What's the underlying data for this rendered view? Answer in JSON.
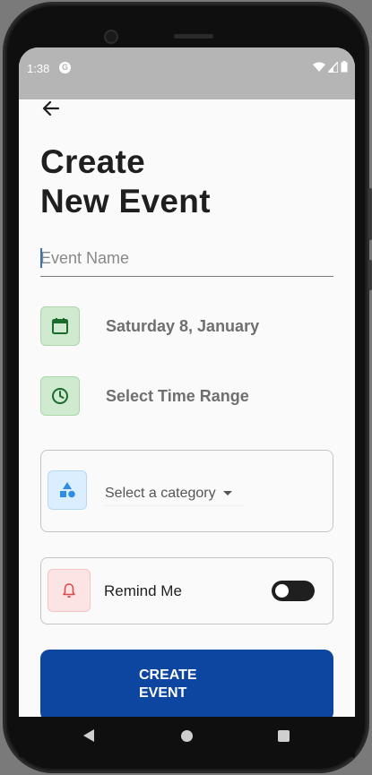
{
  "status_bar": {
    "time": "1:38",
    "notification_icon": "g-circle-icon",
    "icons": [
      "wifi-icon",
      "signal-icon",
      "battery-icon"
    ]
  },
  "header": {
    "back_icon": "arrow-left-icon",
    "title_line1": "Create",
    "title_line2": "New Event"
  },
  "form": {
    "event_name": {
      "value": "",
      "placeholder": "Event Name"
    },
    "date": {
      "icon": "calendar-icon",
      "label": "Saturday 8, January"
    },
    "time": {
      "icon": "clock-icon",
      "label": "Select Time Range"
    },
    "category": {
      "icon": "shapes-icon",
      "label": "Select a category",
      "caret_icon": "caret-down-icon"
    },
    "reminder": {
      "icon": "bell-icon",
      "label": "Remind Me",
      "enabled": false
    },
    "submit_label": "CREATE\nEVENT"
  },
  "nav_bar": {
    "icons": [
      "nav-back-icon",
      "nav-home-icon",
      "nav-recents-icon"
    ]
  },
  "colors": {
    "primary_button": "#0d46a1",
    "green_icon_bg": "#cfeacf",
    "blue_icon_bg": "#dbeeff",
    "red_icon_bg": "#fde4e4",
    "status_bar": "#b5b5b5"
  }
}
